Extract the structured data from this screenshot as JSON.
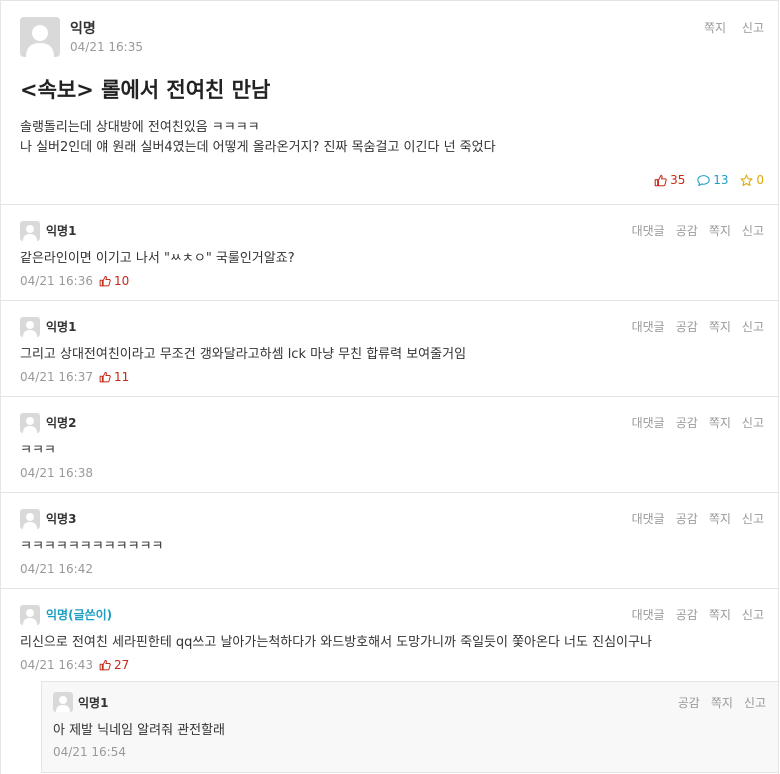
{
  "article": {
    "author": "익명",
    "time": "04/21 16:35",
    "actions": [
      "쪽지",
      "신고"
    ],
    "title": "<속보> 롤에서 전여친 만남",
    "body_lines": [
      "솔랭돌리는데 상대방에 전여친있음 ㅋㅋㅋㅋ",
      "나 실버2인데 얘 원래 실버4였는데 어떻게 올라온거지? 진짜 목숨걸고 이긴다 넌 죽었다"
    ],
    "stats": {
      "votes": "35",
      "comments": "13",
      "scraps": "0"
    }
  },
  "comment_actions": [
    "대댓글",
    "공감",
    "쪽지",
    "신고"
  ],
  "comments": [
    {
      "author": "익명1",
      "text": "같은라인이면 이기고 나서 \"ㅆㅊㅇ\" 국룰인거알죠?",
      "time": "04/21 16:36",
      "votes": "10"
    },
    {
      "author": "익명1",
      "text": "그리고 상대전여친이라고 무조건 갱와달라고하셈 lck 마냥 무친 합류력 보여줄거임",
      "time": "04/21 16:37",
      "votes": "11"
    },
    {
      "author": "익명2",
      "text": "ㅋㅋㅋ",
      "time": "04/21 16:38",
      "votes": ""
    },
    {
      "author": "익명3",
      "text": "ㅋㅋㅋㅋㅋㅋㅋㅋㅋㅋㅋㅋ",
      "time": "04/21 16:42",
      "votes": ""
    },
    {
      "author": "익명(글쓴이)",
      "text": "리신으로 전여친 세라핀한테 qq쓰고 날아가는척하다가 와드방호해서 도망가니까 죽일듯이 쫓아온다 너도 진심이구나",
      "time": "04/21 16:43",
      "votes": "27"
    }
  ],
  "reply": {
    "author": "익명1",
    "actions": [
      "공감",
      "쪽지",
      "신고"
    ],
    "text": "아 제발 닉네임 알려줘 관전할래",
    "time": "04/21 16:54"
  },
  "icons": {
    "vote": "thumbs-up-icon",
    "comment": "speech-bubble-icon",
    "scrap": "star-icon",
    "avatar": "default-user-icon"
  },
  "colors": {
    "vote": "#c62917",
    "comment": "#1f9ec4",
    "scrap": "#e0a800",
    "op_author": "#1f9ec4"
  }
}
